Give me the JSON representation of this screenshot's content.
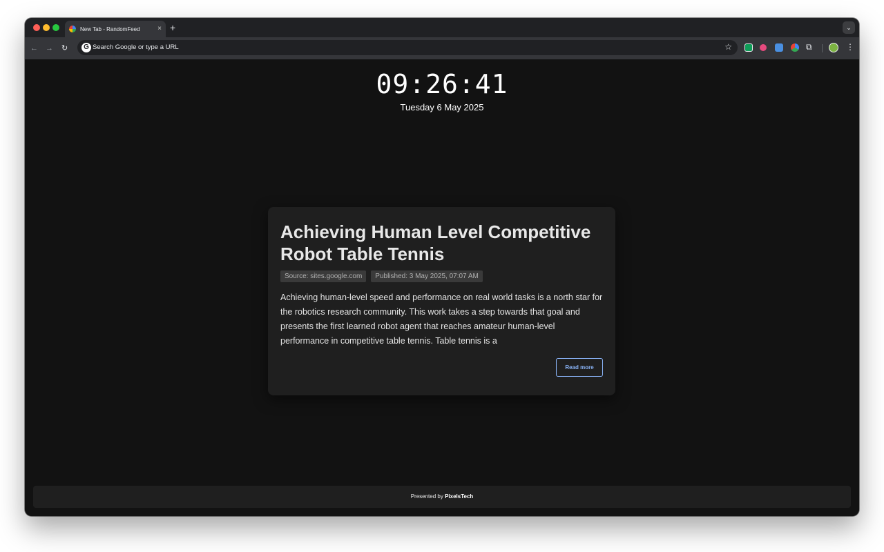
{
  "browser": {
    "tab_title": "New Tab - RandomFeed",
    "tab_close": "×",
    "new_tab": "+",
    "tab_search": "⌄",
    "omnibox_placeholder": "Search Google or type a URL",
    "google_letter": "G",
    "icons": [
      "back-arrow-icon",
      "forward-arrow-icon",
      "reload-icon",
      "star-icon",
      "extensions-icon",
      "profile-icon",
      "menu-icon"
    ]
  },
  "page": {
    "clock": "09:26:41",
    "date": "Tuesday 6 May 2025"
  },
  "article": {
    "title": "Achieving Human Level Competitive Robot Table Tennis",
    "source": "Source: sites.google.com",
    "published": "Published: 3 May 2025, 07:07 AM",
    "summary": "Achieving human-level speed and performance on real world tasks is a north star for the robotics research community. This work takes a step towards that goal and presents the first learned robot agent that reaches amateur human-level performance in competitive table tennis. Table tennis is a",
    "read_more": "Read more"
  },
  "footer": {
    "prefix": "Presented by",
    "brand": "PixelsTech"
  },
  "colors": {
    "page_bg": "#121212",
    "card_bg": "#1f1f1f",
    "accent": "#8ab4f8"
  }
}
